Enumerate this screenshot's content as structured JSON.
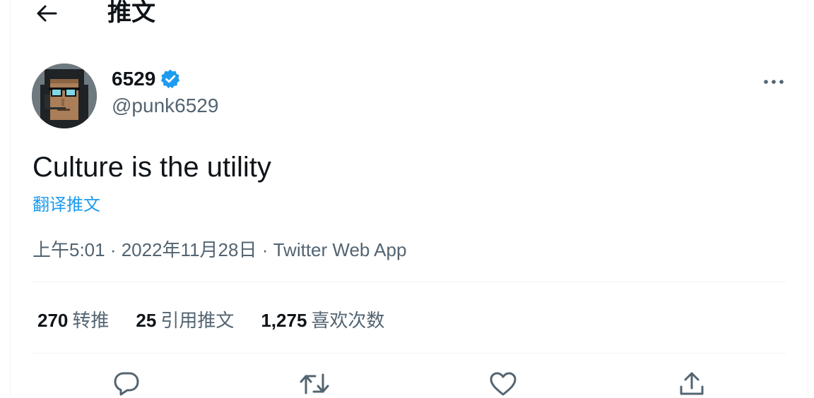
{
  "header": {
    "title": "推文",
    "back_icon": "arrow-left-icon"
  },
  "tweet": {
    "author": {
      "display_name": "6529",
      "handle": "@punk6529",
      "verified": true,
      "verified_color": "#1d9bf0"
    },
    "text": "Culture is the utility",
    "translate_label": "翻译推文",
    "time": "上午5:01",
    "date": "2022年11月28日",
    "separator": " · ",
    "source": "Twitter Web App",
    "stats": [
      {
        "count": "270",
        "label": "转推"
      },
      {
        "count": "25",
        "label": "引用推文"
      },
      {
        "count": "1,275",
        "label": "喜欢次数"
      }
    ],
    "actions": [
      {
        "name": "reply",
        "icon": "speech-bubble-icon"
      },
      {
        "name": "retweet",
        "icon": "retweet-icon"
      },
      {
        "name": "like",
        "icon": "heart-icon"
      },
      {
        "name": "share",
        "icon": "share-upload-icon"
      }
    ]
  },
  "colors": {
    "accent": "#1d9bf0",
    "text_primary": "#0f1419",
    "text_secondary": "#536471",
    "divider": "#eff3f4"
  }
}
